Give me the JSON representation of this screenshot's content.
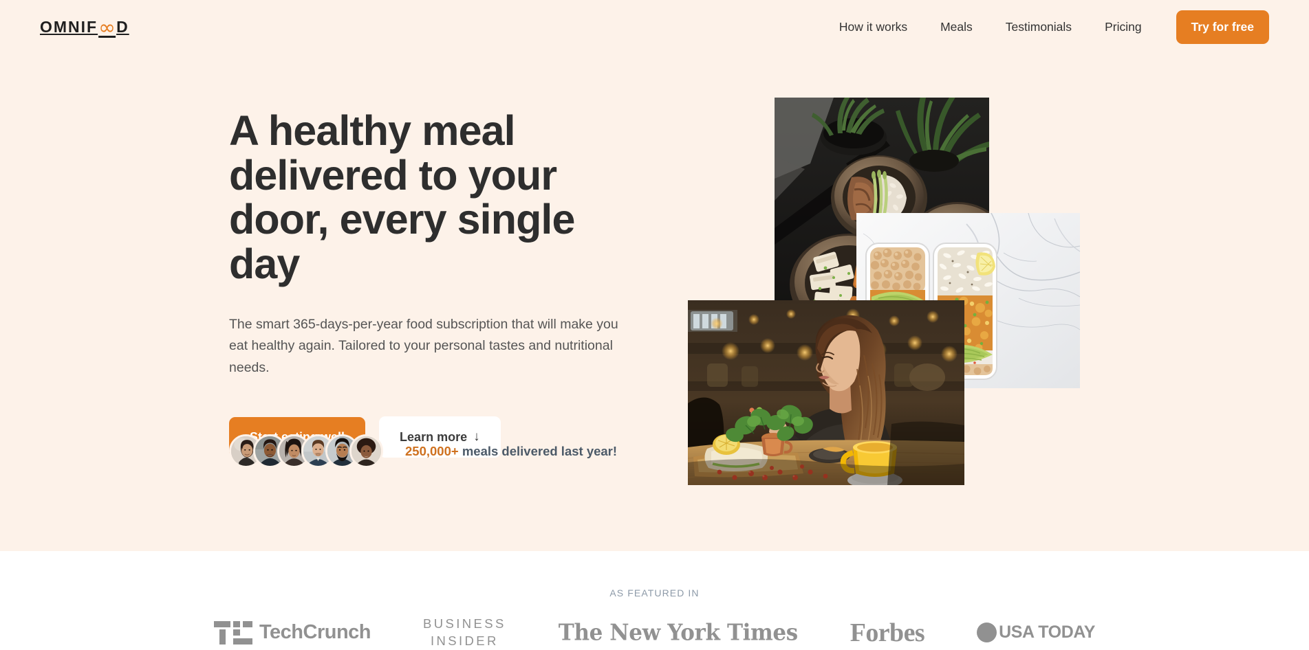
{
  "theme": {
    "background": "#fdf2e9",
    "accent": "#e67e22",
    "accent_dark": "#cf711f",
    "text_dark": "#2e2e2e",
    "text_body": "#555555",
    "featured_bg": "#ffffff",
    "featured_text": "#8d9aa8",
    "logo_gray": "#8a8a8a"
  },
  "header": {
    "logo": {
      "prefix": "OMNIF",
      "infinity": "∞",
      "suffix": "D",
      "full_text": "OMNIFOOD"
    },
    "nav": [
      {
        "label": "How it works",
        "name": "nav-link-how-it-works"
      },
      {
        "label": "Meals",
        "name": "nav-link-meals"
      },
      {
        "label": "Testimonials",
        "name": "nav-link-testimonials"
      },
      {
        "label": "Pricing",
        "name": "nav-link-pricing"
      }
    ],
    "cta_label": "Try for free"
  },
  "hero": {
    "title": "A healthy meal delivered to your door, every single day",
    "description": "The smart 365-days-per-year food subscription that will make you eat healthy again. Tailored to your personal tastes and nutritional needs.",
    "primary_button": "Start eating well",
    "secondary_button": "Learn more",
    "secondary_button_arrow": "↓",
    "delivered": {
      "count": "250,000+",
      "text": " meals delivered last year!",
      "avatar_count": 6,
      "avatars": [
        {
          "name": "customer-avatar-1",
          "skin": "#c99b77",
          "hair": "#2a1d17",
          "bg": "#d8cfc6"
        },
        {
          "name": "customer-avatar-2",
          "skin": "#8d5a35",
          "hair": "#241712",
          "bg": "#9fa4a3"
        },
        {
          "name": "customer-avatar-3",
          "skin": "#c08b63",
          "hair": "#1d1410",
          "bg": "#b8b2ad"
        },
        {
          "name": "customer-avatar-4",
          "skin": "#dcae8c",
          "hair": "#5b3a23",
          "bg": "#cfd3d4"
        },
        {
          "name": "customer-avatar-5",
          "skin": "#b67e52",
          "hair": "#15100d",
          "bg": "#aeb5b8"
        },
        {
          "name": "customer-avatar-6",
          "skin": "#8a5a3c",
          "hair": "#2b1a12",
          "bg": "#ded6cc"
        }
      ]
    },
    "images": [
      {
        "name": "hero-image-bowls",
        "alt": "Bowls of healthy food on a dark table with plants"
      },
      {
        "name": "hero-image-meal-prep",
        "alt": "Two meal prep containers with chickpeas, rice and avocado on marble"
      },
      {
        "name": "hero-image-woman-eating",
        "alt": "Woman eating a healthy meal in a cafe"
      }
    ]
  },
  "featured": {
    "heading": "AS FEATURED IN",
    "logos": [
      {
        "name": "techcrunch-logo",
        "label": "TechCrunch"
      },
      {
        "name": "business-insider-logo",
        "label": "BUSINESS INSIDER",
        "line1": "BUSINESS",
        "line2": "INSIDER"
      },
      {
        "name": "new-york-times-logo",
        "label": "The New York Times"
      },
      {
        "name": "forbes-logo",
        "label": "Forbes"
      },
      {
        "name": "usa-today-logo",
        "label": "USA TODAY"
      }
    ]
  }
}
